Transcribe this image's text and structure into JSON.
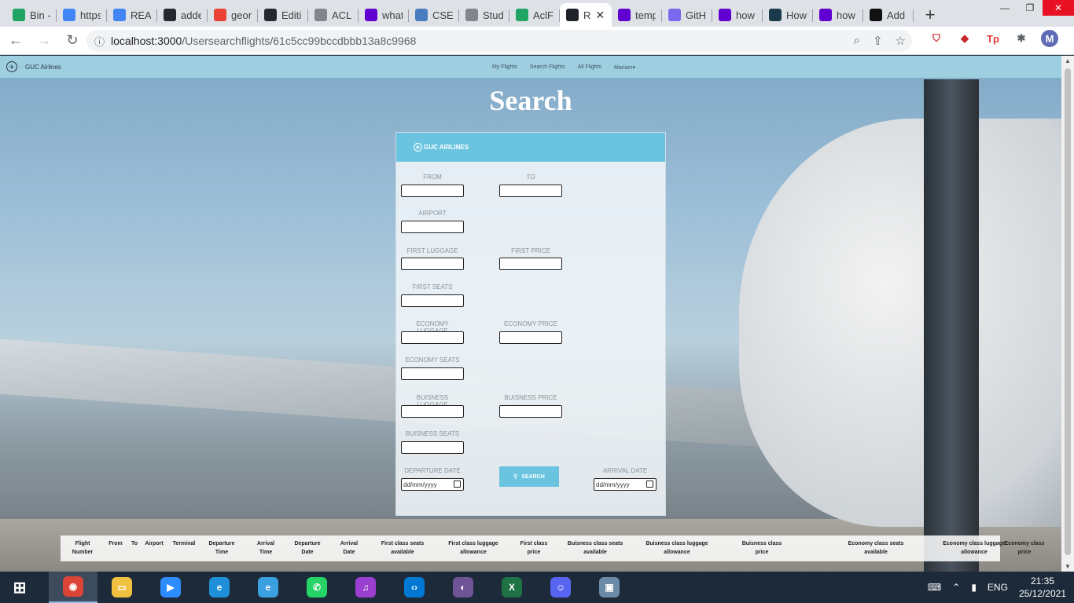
{
  "browser": {
    "tabs": [
      {
        "title": "Bin -",
        "icon": "drive-icon",
        "color": "#1fa463"
      },
      {
        "title": "https",
        "icon": "doc-icon",
        "color": "#4285f4"
      },
      {
        "title": "REAI",
        "icon": "google-icon",
        "color": "#4285f4"
      },
      {
        "title": "adde",
        "icon": "github-icon",
        "color": "#24292e"
      },
      {
        "title": "geor",
        "icon": "gmail-icon",
        "color": "#ea4335"
      },
      {
        "title": "Editi",
        "icon": "github-icon",
        "color": "#24292e"
      },
      {
        "title": "ACL",
        "icon": "globe-icon",
        "color": "#80868b"
      },
      {
        "title": "what",
        "icon": "yahoo-icon",
        "color": "#6001d2"
      },
      {
        "title": "CSEN",
        "icon": "page-icon",
        "color": "#4a7dbf"
      },
      {
        "title": "Stud",
        "icon": "globe-icon",
        "color": "#80868b"
      },
      {
        "title": "AclF",
        "icon": "drive-icon",
        "color": "#1fa463"
      },
      {
        "title": "R",
        "icon": "react-icon",
        "color": "#20232a",
        "active": true
      },
      {
        "title": "temp",
        "icon": "yahoo-icon",
        "color": "#6001d2"
      },
      {
        "title": "GitH",
        "icon": "github-desktop-icon",
        "color": "#7b68ee"
      },
      {
        "title": "how",
        "icon": "yahoo-icon",
        "color": "#6001d2"
      },
      {
        "title": "How",
        "icon": "play-icon",
        "color": "#1b3a4b"
      },
      {
        "title": "how",
        "icon": "yahoo-icon",
        "color": "#6001d2"
      },
      {
        "title": "Add",
        "icon": "p-icon",
        "color": "#111111"
      }
    ],
    "url_host": "localhost:3000",
    "url_path": "/Usersearchflights/61c5cc99bccdbbb13a8c9968",
    "profile_initial": "M"
  },
  "app": {
    "brand": "GUC Airlines",
    "nav": {
      "my_flights": "My Flights",
      "search_flights": "Search Flights",
      "all_flights": "All Flights",
      "user": "Mariam"
    },
    "page_title": "Search",
    "card_header": "GUC AIRLINES",
    "fields": {
      "from": "From",
      "to": "To",
      "airport": "Airport",
      "first_luggage": "First Luggage",
      "first_price": "First Price",
      "first_seats": "First Seats",
      "economy_luggage": "Economy Luggage",
      "economy_price": "Economy Price",
      "economy_seats": "Economy Seats",
      "business_luggage": "Buisness Luggage",
      "business_price": "Buisness Price",
      "business_seats": "Buisness Seats",
      "departure_date": "Departure Date",
      "arrival_date": "Arrival Date",
      "date_placeholder": "dd/mm/yyyy"
    },
    "search_button": "Search",
    "table_headers": [
      [
        "Flight",
        "Number"
      ],
      [
        "From",
        ""
      ],
      [
        "To",
        ""
      ],
      [
        "Airport",
        ""
      ],
      [
        "Terminal",
        ""
      ],
      [
        "Departure",
        "Time"
      ],
      [
        "Arrival",
        "Time"
      ],
      [
        "Departure",
        "Date"
      ],
      [
        "Arrival",
        "Date"
      ],
      [
        "First class seats",
        "available"
      ],
      [
        "First class luggage",
        "allowance"
      ],
      [
        "First class",
        "price"
      ],
      [
        "Buisness class seats",
        "available"
      ],
      [
        "Buisness class luggage",
        "allowance"
      ],
      [
        "Buisness class",
        "price"
      ],
      [
        "Economy class seats",
        "available"
      ],
      [
        "Economy class luggage",
        "allowance"
      ],
      [
        "Economy class",
        "price"
      ]
    ]
  },
  "taskbar": {
    "apps": [
      {
        "name": "chrome-icon",
        "color": "#db4437",
        "glyph": "◉"
      },
      {
        "name": "file-explorer-icon",
        "color": "#f0c040",
        "glyph": "▭"
      },
      {
        "name": "zoom-icon",
        "color": "#2d8cff",
        "glyph": "▶"
      },
      {
        "name": "edge-icon",
        "color": "#1e8fd8",
        "glyph": "e"
      },
      {
        "name": "internet-explorer-icon",
        "color": "#3aa0e0",
        "glyph": "e"
      },
      {
        "name": "whatsapp-icon",
        "color": "#25d366",
        "glyph": "✆"
      },
      {
        "name": "podcast-icon",
        "color": "#9b3fd0",
        "glyph": "♫"
      },
      {
        "name": "vscode-icon",
        "color": "#0078d4",
        "glyph": "‹›"
      },
      {
        "name": "github-desktop-icon",
        "color": "#6e5494",
        "glyph": "◐"
      },
      {
        "name": "excel-icon",
        "color": "#1f7244",
        "glyph": "X"
      },
      {
        "name": "discord-icon",
        "color": "#5865f2",
        "glyph": "☺"
      },
      {
        "name": "screen-recorder-icon",
        "color": "#6c8ba8",
        "glyph": "▣"
      }
    ],
    "language": "ENG",
    "time": "21:35",
    "date": "25/12/2021"
  }
}
